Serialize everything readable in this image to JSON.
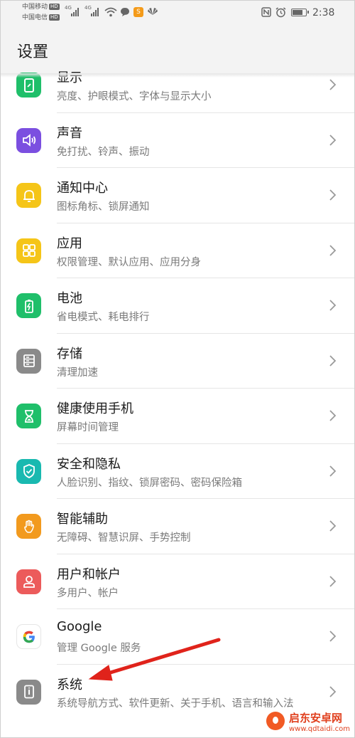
{
  "status_bar": {
    "carrier_1": "中国移动",
    "carrier_2": "中国电信",
    "hd_badge": "HD",
    "network_1": "4G",
    "network_2": "4G",
    "time": "2:38",
    "battery_level": 0.85,
    "icons": [
      "signal-icon",
      "wifi-icon",
      "message-icon",
      "app-notification-icon",
      "huawei-icon",
      "nfc-icon",
      "alarm-icon",
      "battery-icon"
    ]
  },
  "header": {
    "title": "设置"
  },
  "settings": [
    {
      "label": "显示",
      "desc": "亮度、护眼模式、字体与显示大小",
      "icon": "display-icon",
      "color": "#1fbf6a"
    },
    {
      "label": "声音",
      "desc": "免打扰、铃声、振动",
      "icon": "sound-icon",
      "color": "#7b4fe0"
    },
    {
      "label": "通知中心",
      "desc": "图标角标、锁屏通知",
      "icon": "bell-icon",
      "color": "#f5c518"
    },
    {
      "label": "应用",
      "desc": "权限管理、默认应用、应用分身",
      "icon": "apps-icon",
      "color": "#f5c518"
    },
    {
      "label": "电池",
      "desc": "省电模式、耗电排行",
      "icon": "battery-icon",
      "color": "#1fbf6a"
    },
    {
      "label": "存储",
      "desc": "清理加速",
      "icon": "storage-icon",
      "color": "#8a8a8a"
    },
    {
      "label": "健康使用手机",
      "desc": "屏幕时间管理",
      "icon": "hourglass-icon",
      "color": "#1fbf6a"
    },
    {
      "label": "安全和隐私",
      "desc": "人脸识别、指纹、锁屏密码、密码保险箱",
      "icon": "shield-icon",
      "color": "#19b9b0"
    },
    {
      "label": "智能辅助",
      "desc": "无障碍、智慧识屏、手势控制",
      "icon": "hand-icon",
      "color": "#f29a1e"
    },
    {
      "label": "用户和帐户",
      "desc": "多用户、帐户",
      "icon": "user-icon",
      "color": "#ec5b5b"
    },
    {
      "label": "Google",
      "desc": "管理 Google 服务",
      "icon": "google-icon",
      "color": "#ffffff"
    },
    {
      "label": "系统",
      "desc": "系统导航方式、软件更新、关于手机、语言和输入法",
      "icon": "system-icon",
      "color": "#8a8a8a"
    }
  ],
  "annotation": {
    "arrow_color": "#e0231b"
  },
  "watermark": {
    "name": "启东安卓网",
    "url": "www.qdtaidi.com"
  }
}
